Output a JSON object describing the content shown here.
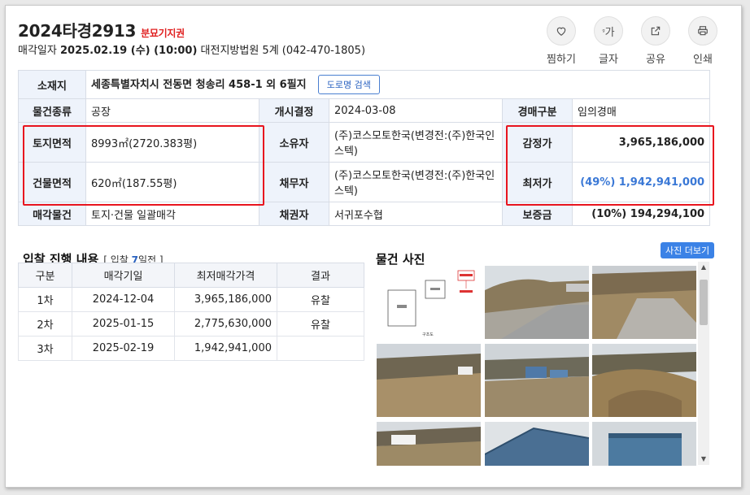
{
  "header": {
    "case_no": "2024타경2913",
    "badge": "분묘기지권",
    "sale_date_label": "매각일자",
    "sale_date": "2025.02.19 (수) (10:00)",
    "court": "대전지방법원 5계 (042-470-1805)"
  },
  "actions": [
    {
      "label": "찜하기",
      "icon": "heart-icon"
    },
    {
      "label": "글자",
      "icon": "text-size-icon",
      "glyph": "가"
    },
    {
      "label": "공유",
      "icon": "share-icon"
    },
    {
      "label": "인쇄",
      "icon": "print-icon"
    }
  ],
  "info": {
    "location_label": "소재지",
    "location": "세종특별자치시 전동면 청송리 458-1 외 6필지",
    "road_button": "도로명 검색",
    "type_label": "물건종류",
    "type": "공장",
    "start_label": "개시결정",
    "start": "2024-03-08",
    "auction_type_label": "경매구분",
    "auction_type": "임의경매",
    "land_label": "토지면적",
    "land": "8993㎡(2720.383평)",
    "owner_label": "소유자",
    "owner": "(주)코스모토한국(변경전:(주)한국인스텍)",
    "appraisal_label": "감정가",
    "appraisal": "3,965,186,000",
    "building_label": "건물면적",
    "building": "620㎡(187.55평)",
    "debtor_label": "채무자",
    "debtor": "(주)코스모토한국(변경전:(주)한국인스텍)",
    "min_label": "최저가",
    "min": "(49%) 1,942,941,000",
    "sale_obj_label": "매각물건",
    "sale_obj": "토지·건물 일괄매각",
    "creditor_label": "채권자",
    "creditor": "서귀포수협",
    "deposit_label": "보증금",
    "deposit": "(10%) 194,294,100"
  },
  "bids": {
    "title": "입찰 진행 내용",
    "sub_prefix": "[ 입찰 ",
    "sub_num": "7",
    "sub_suffix": "일전 ]",
    "columns": [
      "구분",
      "매각기일",
      "최저매각가격",
      "결과"
    ],
    "rows": [
      {
        "round": "1차",
        "date": "2024-12-04",
        "price": "3,965,186,000",
        "result": "유찰"
      },
      {
        "round": "2차",
        "date": "2025-01-15",
        "price": "2,775,630,000",
        "result": "유찰"
      },
      {
        "round": "3차",
        "date": "2025-02-19",
        "price": "1,942,941,000",
        "result": ""
      }
    ]
  },
  "photos": {
    "title": "물건 사진",
    "more": "사진 더보기",
    "map_label": "구조도"
  },
  "colors": {
    "accent": "#3b82e6",
    "highlight": "#e8141e",
    "header_bg": "#eef3fb"
  }
}
